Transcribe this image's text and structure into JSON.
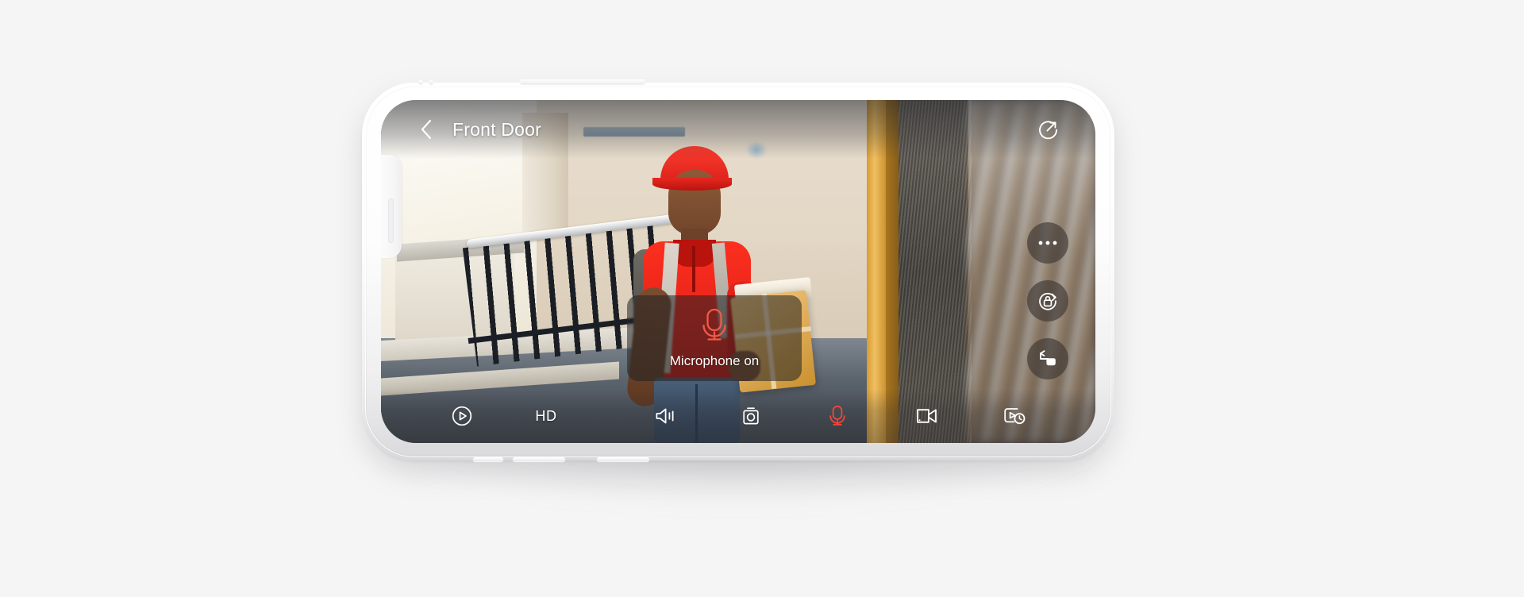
{
  "app": {
    "device": "smartphone-landscape",
    "screen_title": "Front Door"
  },
  "topbar": {
    "back_label": "",
    "back_icon": "chevron-left-icon",
    "title": "Front Door",
    "share_icon": "share-circle-icon"
  },
  "right_rail": {
    "buttons": [
      {
        "icon": "more-options-icon",
        "label": "More options",
        "state": "idle"
      },
      {
        "icon": "privacy-lock-rotate-icon",
        "label": "Privacy lock",
        "state": "idle"
      },
      {
        "icon": "picture-in-picture-icon",
        "label": "Picture in picture",
        "state": "idle"
      }
    ]
  },
  "toast": {
    "icon": "microphone-icon",
    "message": "Microphone on",
    "icon_color": "#f05a4a",
    "visible": true
  },
  "toolbar": {
    "items": [
      {
        "icon": "play-circle-icon",
        "label": "Play",
        "type": "icon",
        "active": false
      },
      {
        "icon": "hd-label",
        "label": "HD",
        "type": "text",
        "active": false
      },
      {
        "icon": "speaker-on-icon",
        "label": "Speaker",
        "type": "icon",
        "active": false
      },
      {
        "icon": "snapshot-camera-icon",
        "label": "Snapshot",
        "type": "icon",
        "active": false
      },
      {
        "icon": "microphone-icon",
        "label": "Microphone",
        "type": "icon",
        "active": true
      },
      {
        "icon": "video-record-icon",
        "label": "Record",
        "type": "icon",
        "active": false
      },
      {
        "icon": "playback-history-icon",
        "label": "Playback",
        "type": "icon",
        "active": false
      }
    ]
  },
  "colors": {
    "accent_active": "#f0463a",
    "page_background": "#f5f5f5",
    "toolbar_text": "#ffffff",
    "button_fill": "rgba(58,52,48,0.62)"
  }
}
